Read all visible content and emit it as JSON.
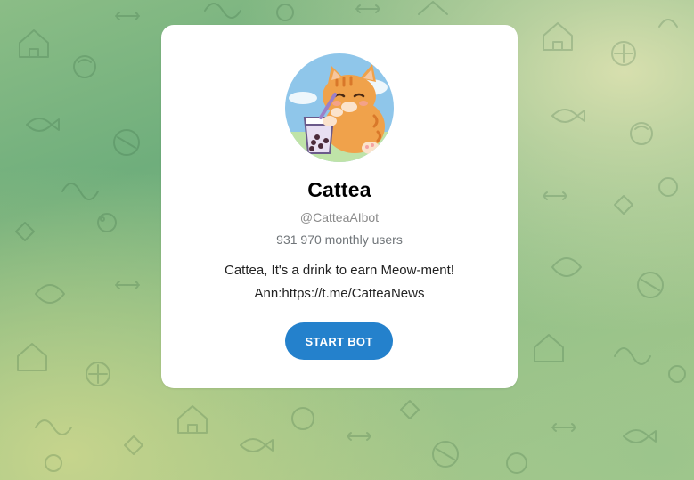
{
  "bot": {
    "name": "Cattea",
    "username": "@CatteaAIbot",
    "monthly_users": "931 970 monthly users",
    "description_line1": "Cattea, It's a drink to earn Meow-ment!",
    "description_line2": "Ann:https://t.me/CatteaNews"
  },
  "actions": {
    "start_label": "START BOT"
  },
  "colors": {
    "accent": "#2481cc",
    "background_green": "#7fb883",
    "card": "#ffffff"
  },
  "icons": {
    "avatar": "cat-with-bubble-tea-avatar",
    "background": "doodle-pattern"
  }
}
